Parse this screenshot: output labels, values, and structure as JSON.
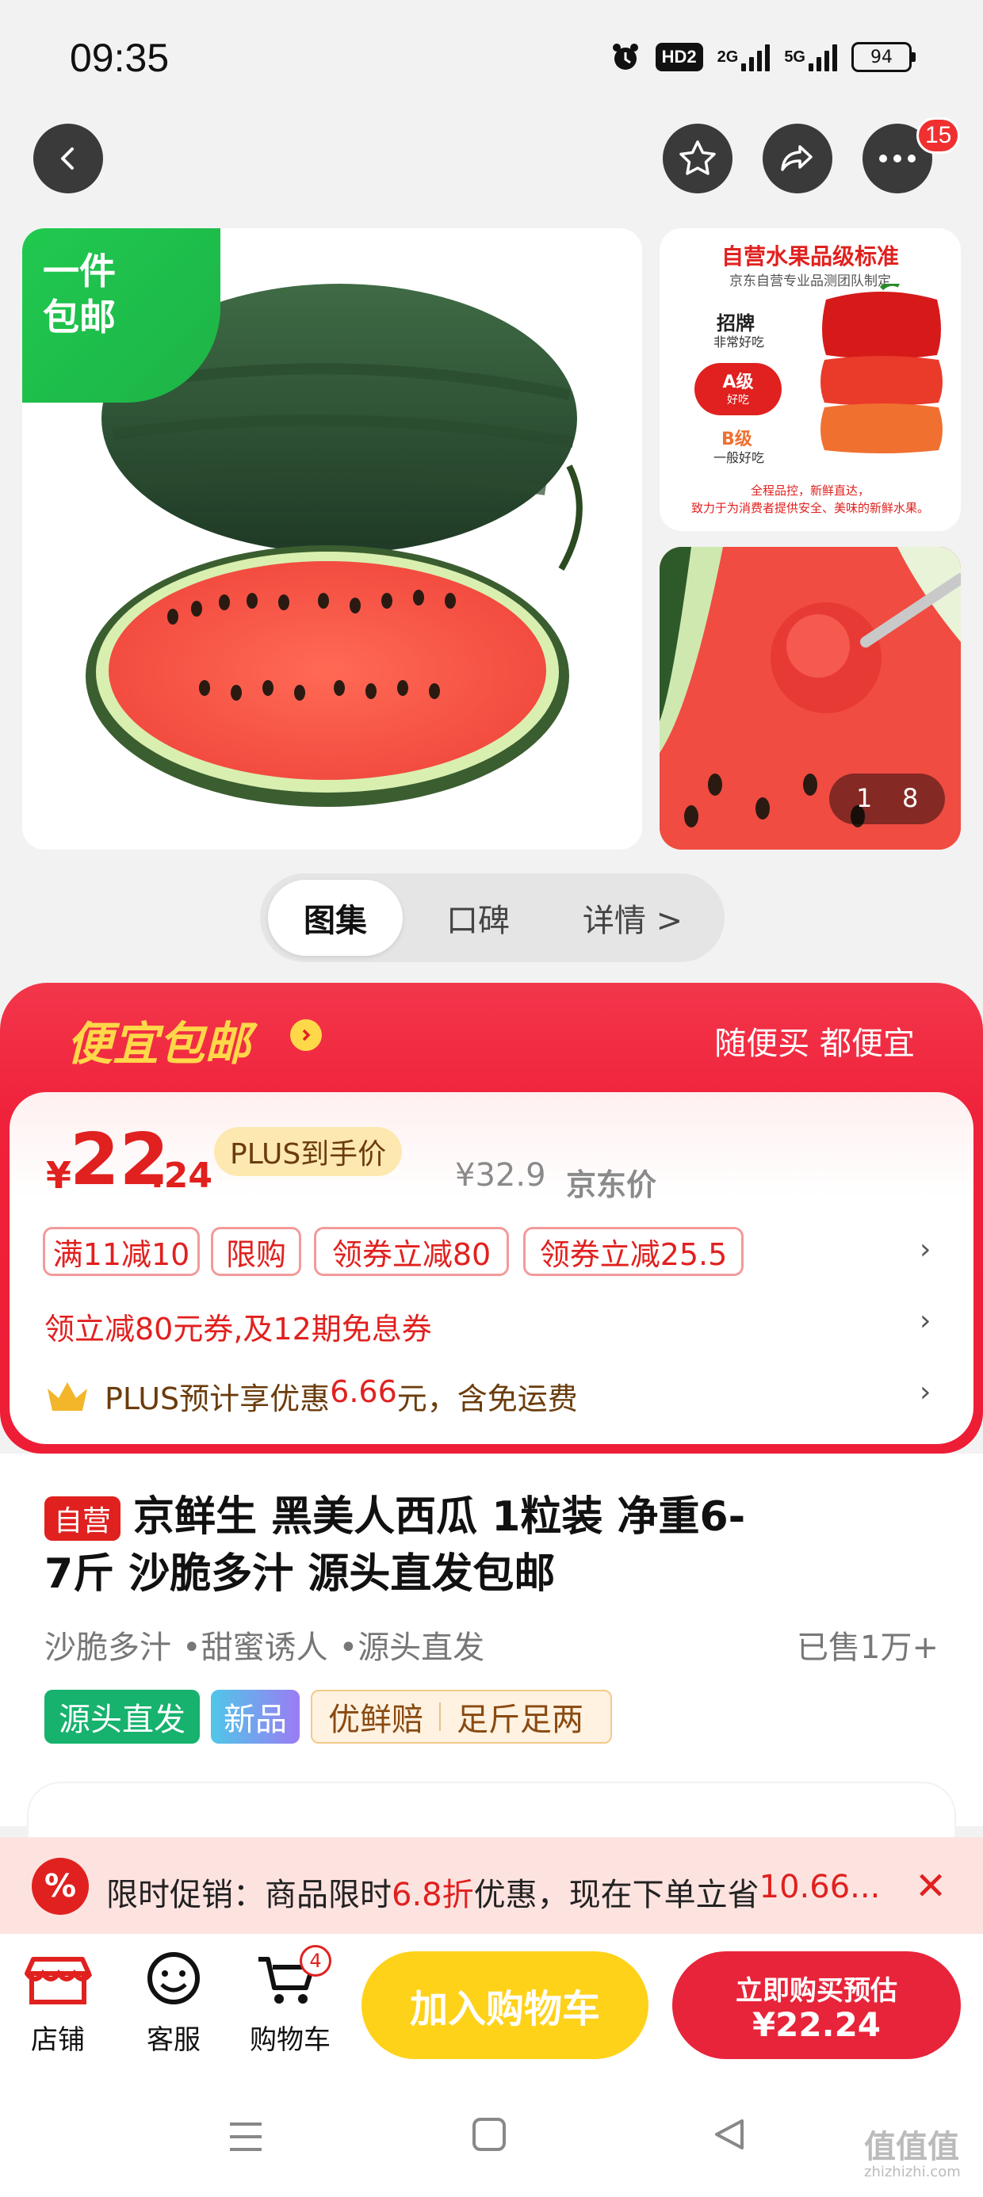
{
  "status_bar": {
    "time": "09:35",
    "hd": "HD2",
    "net1": "2G",
    "net2": "5G",
    "battery": "94"
  },
  "header": {
    "cart_badge": "15"
  },
  "gallery": {
    "badge_line1": "一件",
    "badge_line2": "包邮",
    "grade_card": {
      "title": "自营水果品级标准",
      "subtitle": "京东自营专业品测团队制定",
      "grade1": "招牌",
      "grade1_desc": "非常好吃",
      "grade2": "A级",
      "grade2_desc": "好吃",
      "grade3": "B级",
      "grade3_desc": "一般好吃",
      "footer1": "全程品控，新鲜直达，",
      "footer2": "致力于为消费者提供安全、美味的新鲜水果。"
    },
    "page_current": "1",
    "page_total": "8"
  },
  "tabs": [
    {
      "label": "图集"
    },
    {
      "label": "口碑"
    },
    {
      "label": "详情 >"
    }
  ],
  "promo": {
    "banner_title": "便宜包邮",
    "banner_slogan": "随便买 都便宜",
    "price_symbol": "¥",
    "price_int": "22",
    "price_dec": ".24",
    "plus_label": "PLUS到手价",
    "jd_price": "¥32.9",
    "jd_price_label": "京东价",
    "tags": [
      "满11减10",
      "限购",
      "领券立减80",
      "领券立减25.5"
    ],
    "coupon_line": "领立减80元券,及12期免息券",
    "plus_line_a": "PLUS预计享优惠",
    "plus_line_amount": "6.66",
    "plus_line_b": "元，含免运费"
  },
  "product": {
    "self_tag": "自营",
    "title": "京鲜生 黑美人西瓜 1粒装 净重6-7斤 沙脆多汁 源头直发包邮",
    "features": [
      "沙脆多汁",
      "•甜蜜诱人",
      "•源头直发"
    ],
    "sold": "已售1万+",
    "labels": [
      "源头直发",
      "新品"
    ],
    "service_a": "优鲜赔",
    "service_b": "足斤足两"
  },
  "flash_sale": {
    "text_a": "限时促销：商品限时",
    "discount": "6.8折",
    "text_b": "优惠，现在下单立省",
    "save": "10.66..."
  },
  "bottom_bar": {
    "shop": "店铺",
    "service": "客服",
    "cart": "购物车",
    "cart_count": "4",
    "add_to_cart": "加入购物车",
    "buy_line1": "立即购买预估",
    "buy_line2": "¥22.24"
  },
  "watermark": {
    "text1": "值值值",
    "text2": "zhizhizhi.com"
  },
  "colors": {
    "brand_red": "#f0213a",
    "cta_yellow": "#ffd21a",
    "green": "#1fbf5f"
  }
}
